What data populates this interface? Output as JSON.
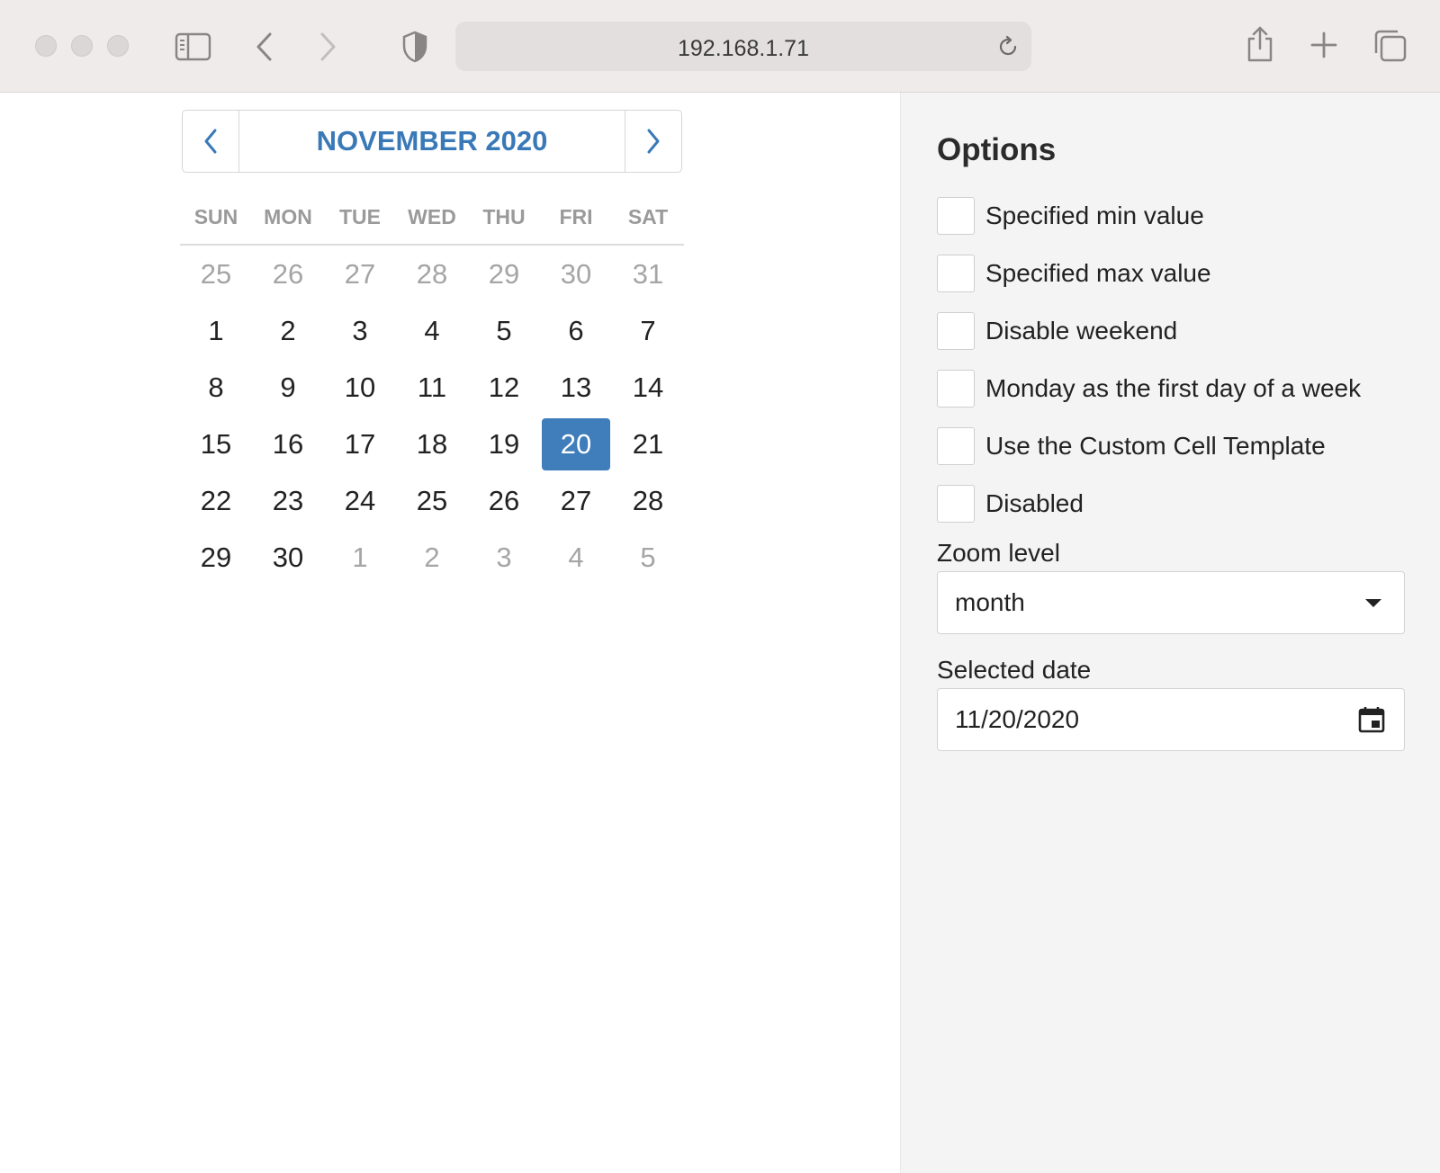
{
  "browser": {
    "address": "192.168.1.71"
  },
  "calendar": {
    "title": "NOVEMBER 2020",
    "weekdays": [
      "SUN",
      "MON",
      "TUE",
      "WED",
      "THU",
      "FRI",
      "SAT"
    ],
    "weeks": [
      [
        {
          "d": "25",
          "other": true
        },
        {
          "d": "26",
          "other": true
        },
        {
          "d": "27",
          "other": true
        },
        {
          "d": "28",
          "other": true
        },
        {
          "d": "29",
          "other": true
        },
        {
          "d": "30",
          "other": true
        },
        {
          "d": "31",
          "other": true
        }
      ],
      [
        {
          "d": "1"
        },
        {
          "d": "2"
        },
        {
          "d": "3"
        },
        {
          "d": "4"
        },
        {
          "d": "5"
        },
        {
          "d": "6"
        },
        {
          "d": "7"
        }
      ],
      [
        {
          "d": "8"
        },
        {
          "d": "9"
        },
        {
          "d": "10"
        },
        {
          "d": "11"
        },
        {
          "d": "12"
        },
        {
          "d": "13"
        },
        {
          "d": "14"
        }
      ],
      [
        {
          "d": "15"
        },
        {
          "d": "16"
        },
        {
          "d": "17"
        },
        {
          "d": "18"
        },
        {
          "d": "19"
        },
        {
          "d": "20",
          "selected": true
        },
        {
          "d": "21"
        }
      ],
      [
        {
          "d": "22"
        },
        {
          "d": "23"
        },
        {
          "d": "24"
        },
        {
          "d": "25"
        },
        {
          "d": "26"
        },
        {
          "d": "27"
        },
        {
          "d": "28"
        }
      ],
      [
        {
          "d": "29"
        },
        {
          "d": "30"
        },
        {
          "d": "1",
          "other": true
        },
        {
          "d": "2",
          "other": true
        },
        {
          "d": "3",
          "other": true
        },
        {
          "d": "4",
          "other": true
        },
        {
          "d": "5",
          "other": true
        }
      ]
    ],
    "accent_color": "#3f7dbb"
  },
  "options": {
    "title": "Options",
    "checkboxes": [
      {
        "label": "Specified min value",
        "checked": false
      },
      {
        "label": "Specified max value",
        "checked": false
      },
      {
        "label": "Disable weekend",
        "checked": false
      },
      {
        "label": "Monday as the first day of a week",
        "checked": false
      },
      {
        "label": "Use the Custom Cell Template",
        "checked": false
      },
      {
        "label": "Disabled",
        "checked": false
      }
    ],
    "zoom_label": "Zoom level",
    "zoom_value": "month",
    "date_label": "Selected date",
    "date_value": "11/20/2020"
  }
}
